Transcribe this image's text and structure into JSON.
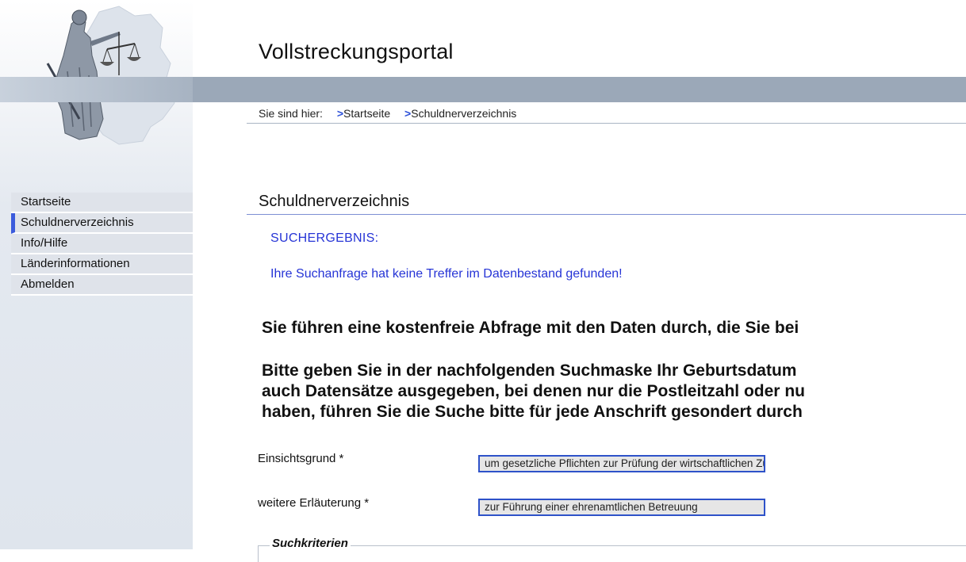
{
  "header": {
    "title": "Vollstreckungsportal"
  },
  "breadcrumb": {
    "prefix": "Sie sind hier:",
    "items": [
      {
        "arrow": ">",
        "label": "Startseite"
      },
      {
        "arrow": ">",
        "label": "Schuldnerverzeichnis"
      }
    ]
  },
  "sidebar": {
    "items": [
      {
        "label": "Startseite",
        "active": false
      },
      {
        "label": "Schuldnerverzeichnis",
        "active": true
      },
      {
        "label": "Info/Hilfe",
        "active": false
      },
      {
        "label": "Länderinformationen",
        "active": false
      },
      {
        "label": "Abmelden",
        "active": false
      }
    ]
  },
  "main": {
    "section_title": "Schuldnerverzeichnis",
    "result_heading": "SUCHERGEBNIS:",
    "result_message": "Ihre Suchanfrage hat keine Treffer im Datenbestand gefunden!",
    "notice_1": "Sie führen eine kostenfreie Abfrage mit den Daten durch, die Sie bei",
    "notice_2_lines": [
      "Bitte geben Sie in der nachfolgenden Suchmaske Ihr Geburtsdatum",
      "auch Datensätze ausgegeben, bei denen nur die Postleitzahl oder nu",
      "haben, führen Sie die Suche bitte für jede Anschrift gesondert durch"
    ],
    "fields": [
      {
        "label": "Einsichtsgrund *",
        "value": "um gesetzliche Pflichten zur Prüfung der wirtschaftlichen Zuverlä"
      },
      {
        "label": "weitere Erläuterung *",
        "value": "zur Führung einer ehrenamtlichen Betreuung"
      }
    ],
    "fieldset_legend": "Suchkriterien"
  },
  "colors": {
    "accent_blue": "#2634d6",
    "header_bar": "#9ba8b8",
    "nav_bg": "#dfe3ea",
    "nav_active_marker": "#3b5bdc",
    "input_border": "#2e52c9"
  }
}
